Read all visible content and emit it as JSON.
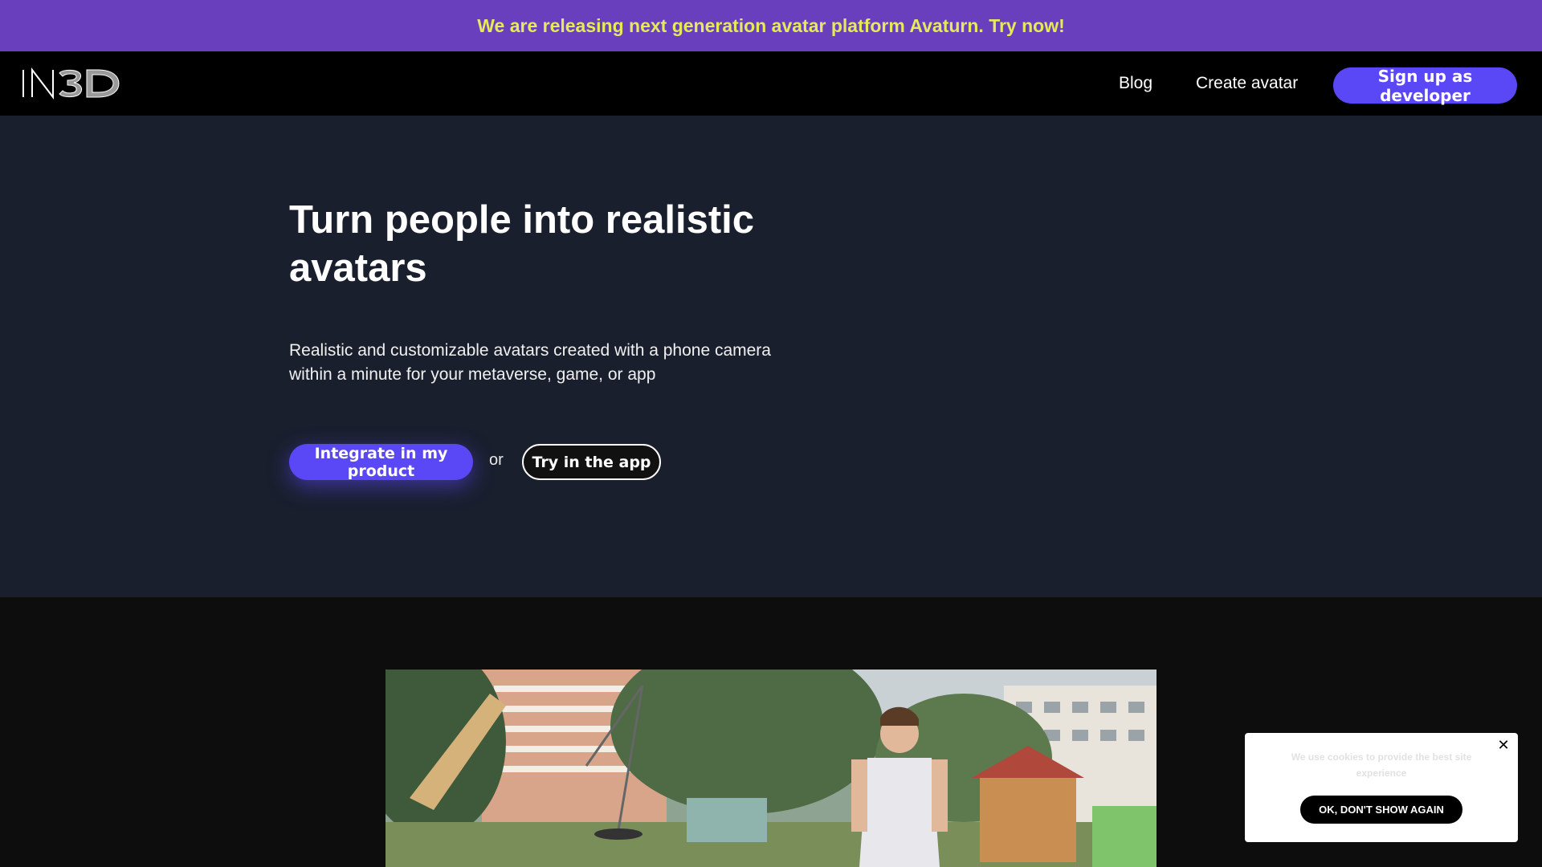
{
  "announcement": {
    "text": "We are releasing next generation avatar platform Avaturn. Try now!",
    "color": "#e4ea5a",
    "background": "#6a3fbe"
  },
  "nav": {
    "logo": "IN3D",
    "links": [
      {
        "label": "Blog"
      },
      {
        "label": "Create avatar"
      }
    ],
    "cta": "Sign up as developer"
  },
  "hero": {
    "title": "Turn people into realistic avatars",
    "subtitle": "Realistic and customizable avatars created with a phone camera within a minute for your metaverse, game, or app",
    "primary_button": "Integrate in my product",
    "or_text": "or",
    "secondary_button": "Try in the app",
    "background": "#1a1f2e",
    "accent": "#5a47f5"
  },
  "video": {
    "icon": "playground-video-preview"
  },
  "cookie": {
    "text": "We use cookies to provide the best site experience",
    "button": "OK, DON'T SHOW AGAIN",
    "close_icon": "close-icon"
  }
}
